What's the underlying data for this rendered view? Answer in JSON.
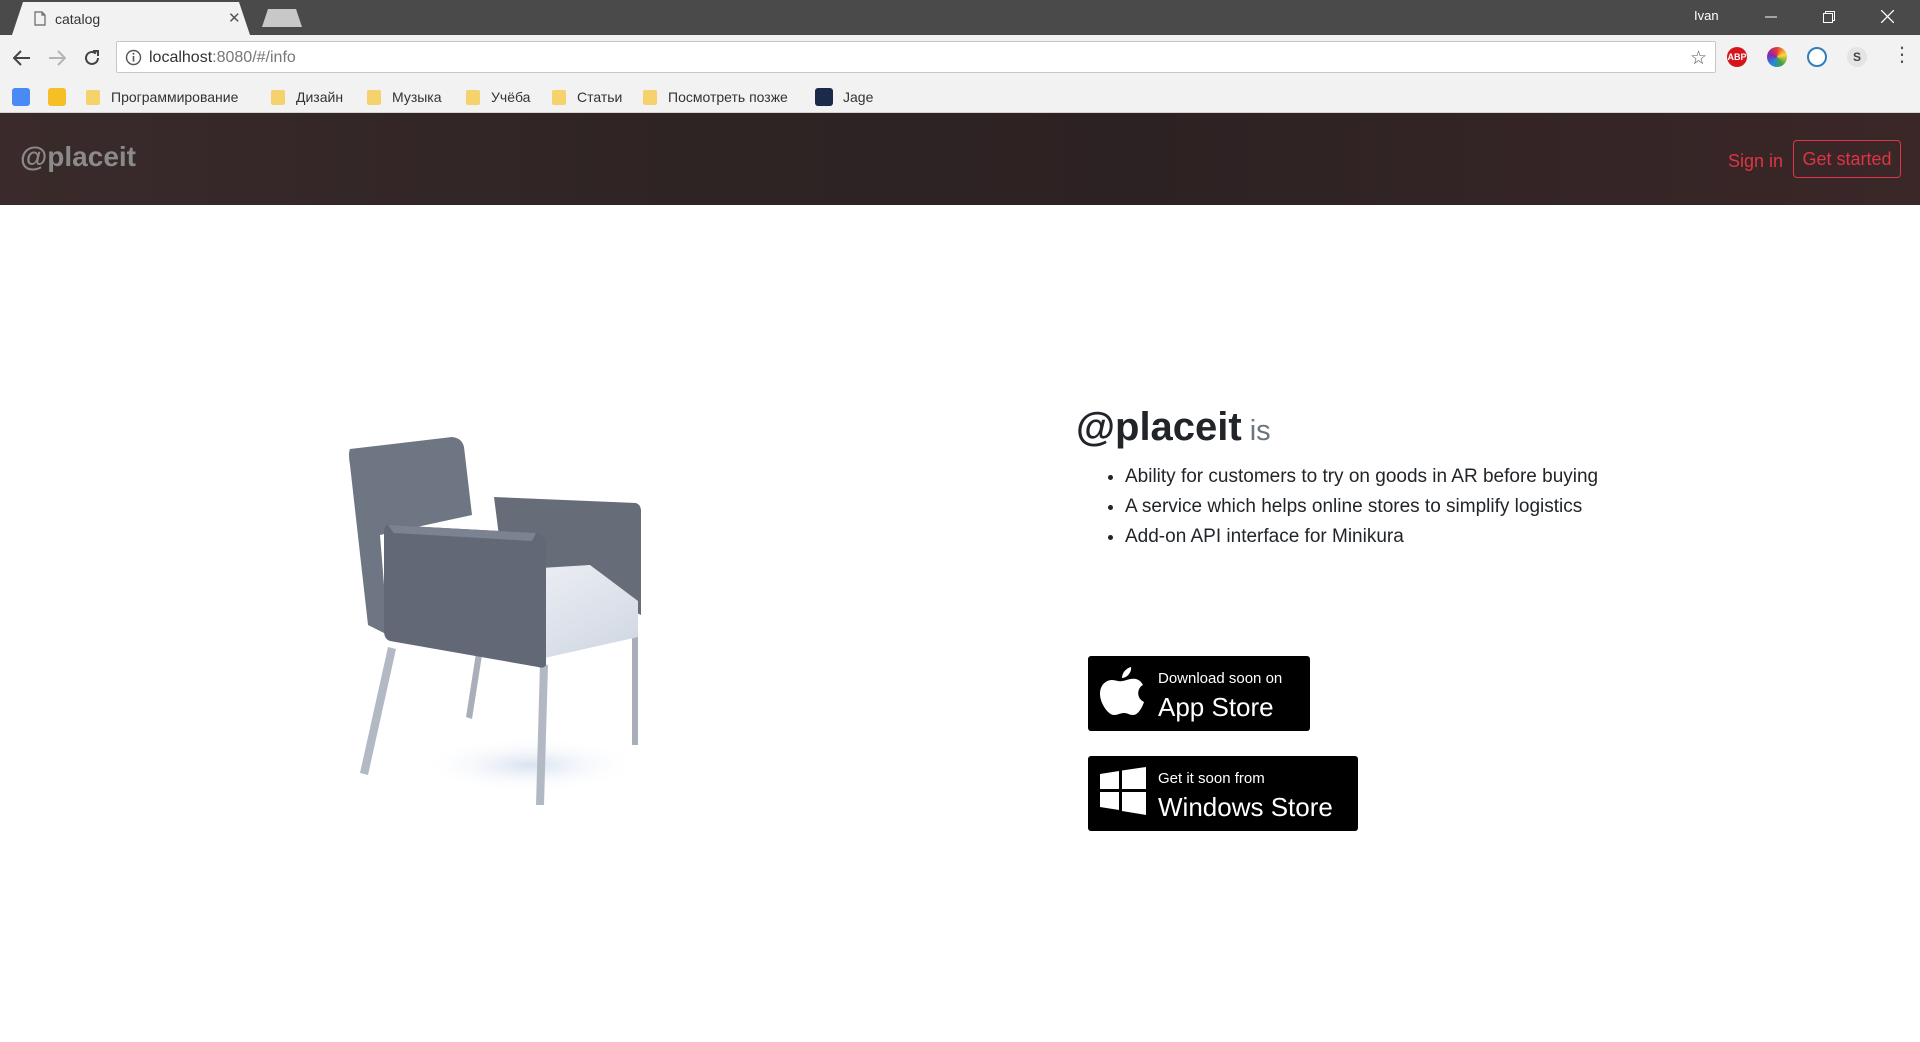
{
  "browser": {
    "tab_title": "catalog",
    "user_name": "Ivan",
    "url_host": "localhost",
    "url_rest": ":8080/#/info",
    "bookmarks": [
      "Программирование",
      "Дизайн",
      "Музыка",
      "Учёба",
      "Статьи",
      "Посмотреть позже",
      "Jage"
    ],
    "extensions": {
      "abp_label": "ABP",
      "s_label": "S"
    }
  },
  "navbar": {
    "brand": "@placeit",
    "sign_in": "Sign in",
    "get_started": "Get started"
  },
  "hero": {
    "title": "@placeit",
    "title_suffix": "is",
    "features": [
      "Ability for customers to try on goods in AR before buying",
      "A service which helps online stores to simplify logistics",
      "Add-on API interface for Minikura"
    ]
  },
  "stores": {
    "app_store_small": "Download soon on",
    "app_store_big": "App Store",
    "windows_store_small": "Get it soon from",
    "windows_store_big": "Windows Store"
  },
  "colors": {
    "accent": "#dc3545",
    "navbar_bg": "#2f2424",
    "chair": "#6f7683"
  }
}
